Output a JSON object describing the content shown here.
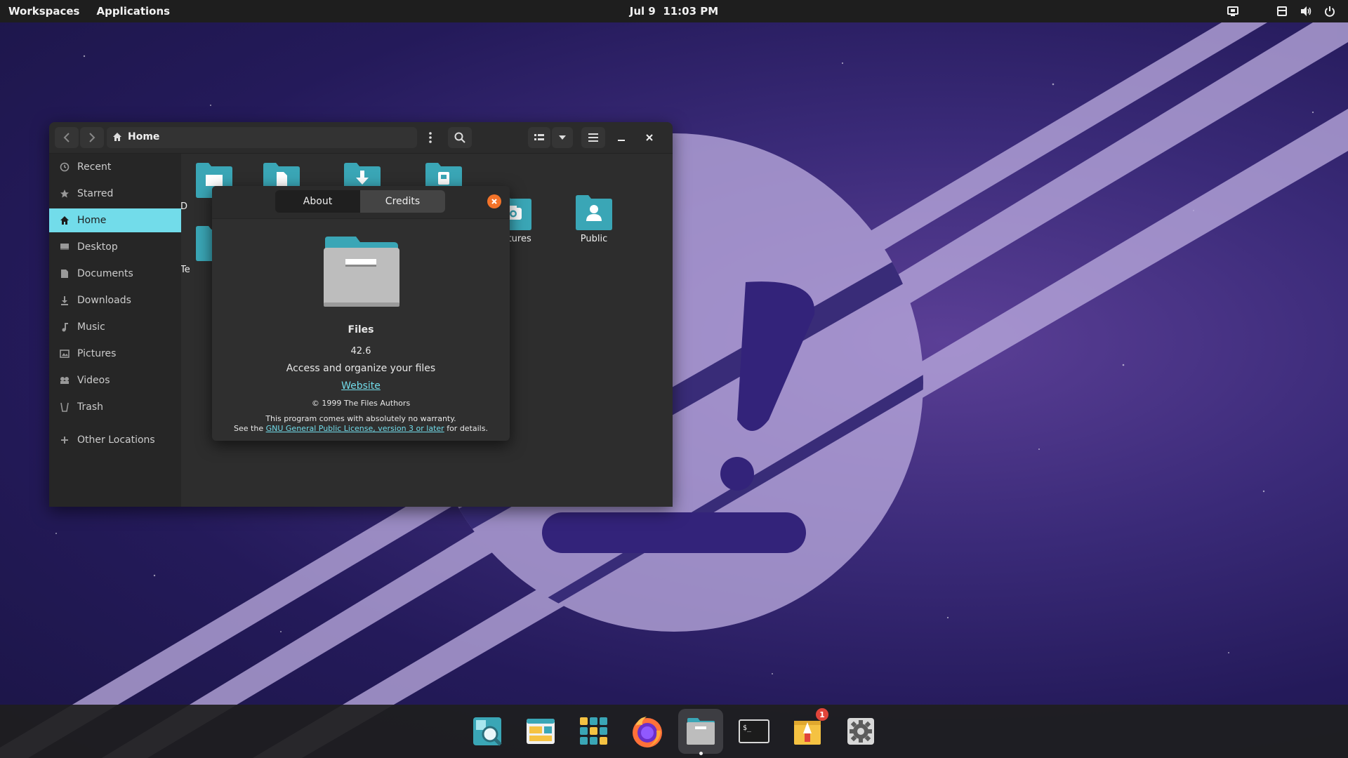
{
  "topbar": {
    "workspaces": "Workspaces",
    "applications": "Applications",
    "date": "Jul 9",
    "time": "11:03 PM",
    "tray_icons": [
      "screen-share-icon",
      "notification-icon",
      "volume-icon",
      "power-icon"
    ]
  },
  "files_window": {
    "path_label": "Home",
    "sidebar": [
      {
        "label": "Recent",
        "icon": "clock-icon"
      },
      {
        "label": "Starred",
        "icon": "star-icon"
      },
      {
        "label": "Home",
        "icon": "home-icon",
        "active": true
      },
      {
        "label": "Desktop",
        "icon": "desktop-icon"
      },
      {
        "label": "Documents",
        "icon": "document-icon"
      },
      {
        "label": "Downloads",
        "icon": "download-icon"
      },
      {
        "label": "Music",
        "icon": "music-icon"
      },
      {
        "label": "Pictures",
        "icon": "picture-icon"
      },
      {
        "label": "Videos",
        "icon": "video-icon"
      },
      {
        "label": "Trash",
        "icon": "trash-icon"
      },
      {
        "label": "Other Locations",
        "icon": "plus-icon"
      }
    ],
    "grid_items": [
      {
        "label": "D",
        "icon": "desktop-folder-icon"
      },
      {
        "label": "",
        "icon": "documents-folder-icon"
      },
      {
        "label": "",
        "icon": "downloads-folder-icon"
      },
      {
        "label": "",
        "icon": "music-folder-icon"
      },
      {
        "label": "Pictures",
        "icon": "pictures-folder-icon"
      },
      {
        "label": "Public",
        "icon": "public-folder-icon"
      },
      {
        "label": "Te",
        "icon": "templates-folder-icon"
      }
    ]
  },
  "about_dialog": {
    "tab_about": "About",
    "tab_credits": "Credits",
    "app_name": "Files",
    "version": "42.6",
    "description": "Access and organize your files",
    "website": "Website",
    "copyright": "© 1999 The Files Authors",
    "warranty": "This program comes with absolutely no warranty.",
    "license_prefix": "See the ",
    "license_link": "GNU General Public License, version 3 or later",
    "license_suffix": " for details."
  },
  "dock": {
    "items": [
      "search-app-icon",
      "workspaces-app-icon",
      "app-grid-icon",
      "firefox-icon",
      "files-app-icon",
      "terminal-icon",
      "app-store-icon",
      "settings-icon"
    ],
    "running_item": "files-app-icon",
    "badge_count": "1"
  },
  "colors": {
    "accent": "#72dcea",
    "folder_teal": "#3aa6b6",
    "close_orange": "#f37329",
    "badge_red": "#e0443a"
  }
}
